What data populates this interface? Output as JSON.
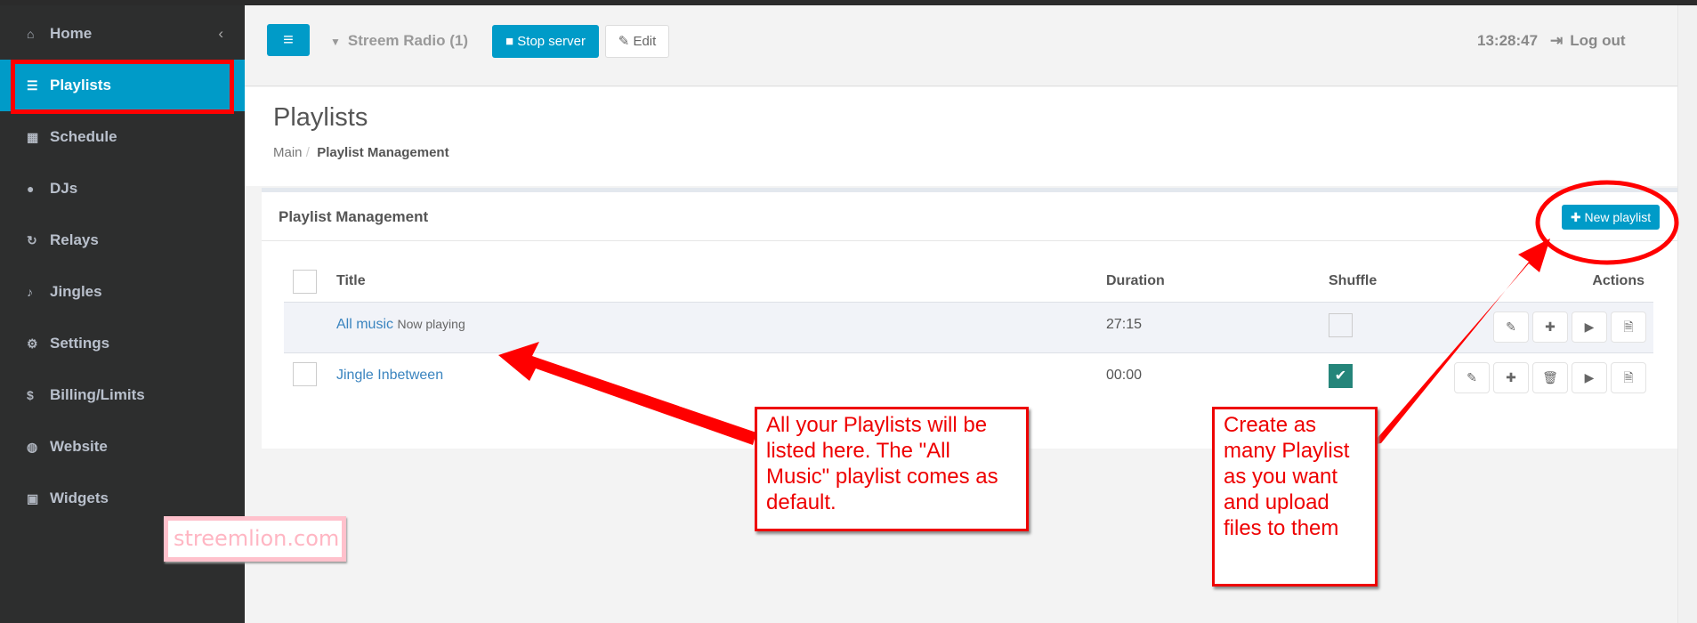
{
  "sidebar": {
    "items": [
      {
        "label": "Home",
        "icon": "home-icon",
        "glyph": "⌂"
      },
      {
        "label": "Playlists",
        "icon": "list-icon",
        "glyph": "☰"
      },
      {
        "label": "Schedule",
        "icon": "calendar-icon",
        "glyph": "▦"
      },
      {
        "label": "DJs",
        "icon": "user-icon",
        "glyph": "●"
      },
      {
        "label": "Relays",
        "icon": "refresh-icon",
        "glyph": "↻"
      },
      {
        "label": "Jingles",
        "icon": "bell-icon",
        "glyph": "♪"
      },
      {
        "label": "Settings",
        "icon": "gears-icon",
        "glyph": "⚙"
      },
      {
        "label": "Billing/Limits",
        "icon": "dollar-icon",
        "glyph": "$"
      },
      {
        "label": "Website",
        "icon": "globe-icon",
        "glyph": "◍"
      },
      {
        "label": "Widgets",
        "icon": "gift-icon",
        "glyph": "▣"
      }
    ],
    "active": "Playlists",
    "collapse_glyph": "‹"
  },
  "topbar": {
    "menu_glyph": "≡",
    "station": "Streem Radio (1)",
    "stop_label": "Stop server",
    "edit_label": "Edit",
    "time": "13:28:47",
    "logout_label": "Log out"
  },
  "page": {
    "title": "Playlists",
    "breadcrumb": [
      "Main",
      "Playlist Management"
    ]
  },
  "panel": {
    "title": "Playlist Management",
    "new_label": "New playlist",
    "columns": {
      "title": "Title",
      "duration": "Duration",
      "shuffle": "Shuffle",
      "actions": "Actions"
    },
    "rows": [
      {
        "title": "All music",
        "badge": "Now playing",
        "duration": "27:15",
        "shuffle": false
      },
      {
        "title": "Jingle Inbetween",
        "badge": "",
        "duration": "00:00",
        "shuffle": true
      }
    ]
  },
  "annotations": {
    "left": "All your Playlists will be listed here. The \"All Music\" playlist comes as default.",
    "right": "Create as many Playlist as you want and upload files to them",
    "watermark": "streemlion.com"
  },
  "colors": {
    "accent": "#009bc8",
    "annotation": "#ff0000",
    "shuffle_on": "#25857a"
  }
}
